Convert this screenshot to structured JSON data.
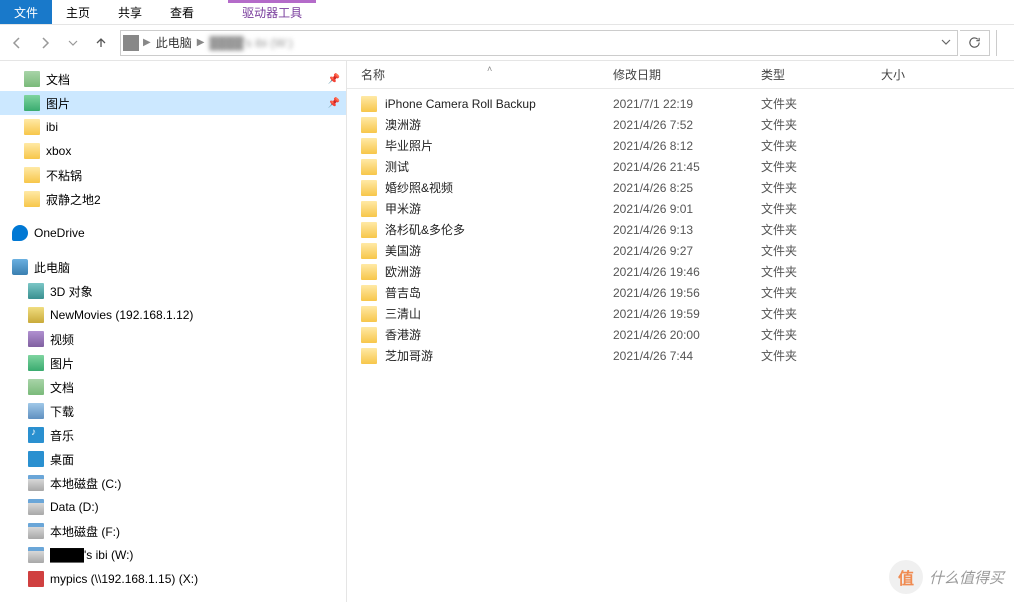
{
  "ribbon": {
    "tabs": [
      "文件",
      "主页",
      "共享",
      "查看"
    ],
    "context_tab": "驱动器工具"
  },
  "breadcrumb": {
    "items": [
      "此电脑",
      "████'s ibi (W:)"
    ]
  },
  "sidebar": {
    "quick": [
      {
        "label": "文档",
        "icon": "docs-ic",
        "pinned": true
      },
      {
        "label": "图片",
        "icon": "pics-ic",
        "pinned": true,
        "selected": true
      },
      {
        "label": "ibi",
        "icon": "folder-ic"
      },
      {
        "label": "xbox",
        "icon": "folder-ic"
      },
      {
        "label": "不粘锅",
        "icon": "folder-ic"
      },
      {
        "label": "寂静之地2",
        "icon": "folder-ic"
      }
    ],
    "onedrive": {
      "label": "OneDrive",
      "icon": "onedrive-ic"
    },
    "thispc": {
      "label": "此电脑",
      "icon": "pc-ic",
      "children": [
        {
          "label": "3D 对象",
          "icon": "obj3d-ic"
        },
        {
          "label": "NewMovies (192.168.1.12)",
          "icon": "srv-ic"
        },
        {
          "label": "视频",
          "icon": "vid-ic"
        },
        {
          "label": "图片",
          "icon": "pics-ic"
        },
        {
          "label": "文档",
          "icon": "docs-ic"
        },
        {
          "label": "下载",
          "icon": "dl-ic"
        },
        {
          "label": "音乐",
          "icon": "mus-ic"
        },
        {
          "label": "桌面",
          "icon": "desk-ic"
        },
        {
          "label": "本地磁盘 (C:)",
          "icon": "disk-ic"
        },
        {
          "label": "Data (D:)",
          "icon": "disk-ic"
        },
        {
          "label": "本地磁盘 (F:)",
          "icon": "disk-ic"
        },
        {
          "label": "████'s ibi (W:)",
          "icon": "disk-ic"
        },
        {
          "label": "mypics (\\\\192.168.1.15) (X:)",
          "icon": "net-ic"
        }
      ]
    }
  },
  "columns": {
    "name": "名称",
    "date": "修改日期",
    "type": "类型",
    "size": "大小"
  },
  "files": [
    {
      "name": "iPhone Camera Roll Backup",
      "date": "2021/7/1 22:19",
      "type": "文件夹"
    },
    {
      "name": "澳洲游",
      "date": "2021/4/26 7:52",
      "type": "文件夹"
    },
    {
      "name": "毕业照片",
      "date": "2021/4/26 8:12",
      "type": "文件夹"
    },
    {
      "name": "测试",
      "date": "2021/4/26 21:45",
      "type": "文件夹"
    },
    {
      "name": "婚纱照&视频",
      "date": "2021/4/26 8:25",
      "type": "文件夹"
    },
    {
      "name": "甲米游",
      "date": "2021/4/26 9:01",
      "type": "文件夹"
    },
    {
      "name": "洛杉矶&多伦多",
      "date": "2021/4/26 9:13",
      "type": "文件夹"
    },
    {
      "name": "美国游",
      "date": "2021/4/26 9:27",
      "type": "文件夹"
    },
    {
      "name": "欧洲游",
      "date": "2021/4/26 19:46",
      "type": "文件夹"
    },
    {
      "name": "普吉岛",
      "date": "2021/4/26 19:56",
      "type": "文件夹"
    },
    {
      "name": "三清山",
      "date": "2021/4/26 19:59",
      "type": "文件夹"
    },
    {
      "name": "香港游",
      "date": "2021/4/26 20:00",
      "type": "文件夹"
    },
    {
      "name": "芝加哥游",
      "date": "2021/4/26 7:44",
      "type": "文件夹"
    }
  ],
  "watermark": {
    "icon": "值",
    "text": "什么值得买"
  }
}
